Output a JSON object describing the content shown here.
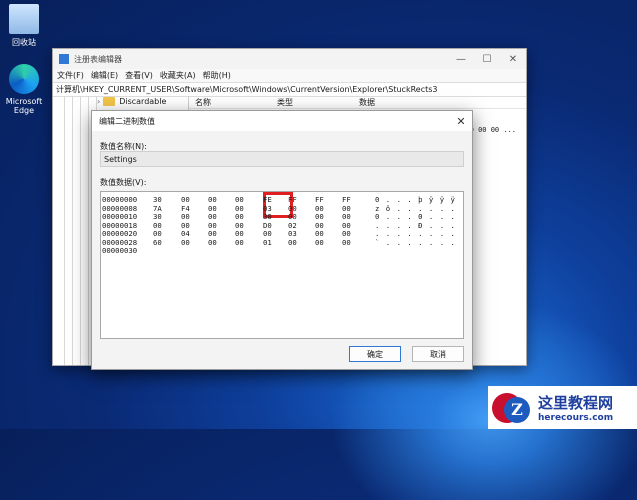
{
  "desktop": {
    "recycle_bin": "回收站",
    "edge_line1": "Microsoft",
    "edge_line2": "Edge"
  },
  "regedit": {
    "title": "注册表编辑器",
    "menus": [
      "文件(F)",
      "编辑(E)",
      "查看(V)",
      "收藏夹(A)",
      "帮助(H)"
    ],
    "address": "计算机\\HKEY_CURRENT_USER\\Software\\Microsoft\\Windows\\CurrentVersion\\Explorer\\StuckRects3",
    "tree_item": "Discardable",
    "columns": [
      "名称",
      "类型",
      "数据"
    ],
    "data_peek": "30 00 00 00 ..."
  },
  "dialog": {
    "title": "编辑二进制数值",
    "name_label": "数值名称(N):",
    "name_value": "Settings",
    "data_label": "数值数据(V):",
    "ok": "确定",
    "cancel": "取消",
    "rows": [
      {
        "offset": "00000000",
        "bytes": [
          "30",
          "00",
          "00",
          "00",
          "FE",
          "FF",
          "FF",
          "FF"
        ],
        "ascii": "0 . . . þ ÿ ÿ ÿ"
      },
      {
        "offset": "00000008",
        "bytes": [
          "7A",
          "F4",
          "00",
          "00",
          "03",
          "00",
          "00",
          "00"
        ],
        "ascii": "z ô . . . . . ."
      },
      {
        "offset": "00000010",
        "bytes": [
          "30",
          "00",
          "00",
          "00",
          "30",
          "00",
          "00",
          "00"
        ],
        "ascii": "0 . . . 0 . . ."
      },
      {
        "offset": "00000018",
        "bytes": [
          "00",
          "00",
          "00",
          "00",
          "D0",
          "02",
          "00",
          "00"
        ],
        "ascii": ". . . . Ð . . ."
      },
      {
        "offset": "00000020",
        "bytes": [
          "00",
          "04",
          "00",
          "00",
          "00",
          "03",
          "00",
          "00"
        ],
        "ascii": ". . . . . . . ."
      },
      {
        "offset": "00000028",
        "bytes": [
          "60",
          "00",
          "00",
          "00",
          "01",
          "00",
          "00",
          "00"
        ],
        "ascii": "` . . . . . . ."
      },
      {
        "offset": "00000030",
        "bytes": [],
        "ascii": ""
      }
    ]
  },
  "watermark": {
    "logo_letter": "Z",
    "cn": "这里教程网",
    "url": "herecours.com"
  }
}
